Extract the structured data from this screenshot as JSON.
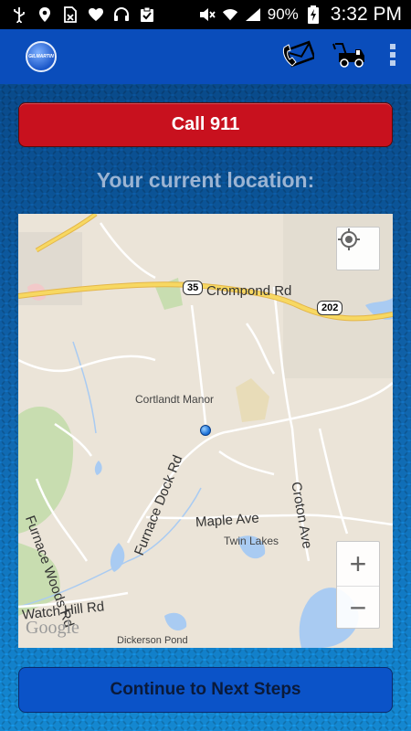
{
  "status_bar": {
    "battery_percent": "90%",
    "time": "3:32 PM"
  },
  "app_bar": {
    "logo_text": "GILMARTIN",
    "icons": [
      "phone-envelope-icon",
      "tow-truck-icon",
      "overflow-menu-icon"
    ]
  },
  "main": {
    "call_button_label": "Call 911",
    "location_label": "Your current location:",
    "continue_button_label": "Continue to Next Steps"
  },
  "map": {
    "labels": {
      "crompond_rd": "Crompond Rd",
      "route_35": "35",
      "route_202": "202",
      "cortlandt_manor": "Cortlandt Manor",
      "furnace_woods_rd": "Furnace Woods Rd",
      "furnace_dock_rd": "Furnace Dock Rd",
      "maple_ave": "Maple Ave",
      "croton_ave": "Croton Ave",
      "twin_lakes": "Twin Lakes",
      "watch_hill_rd": "Watch Hill Rd",
      "dickerson_pond": "Dickerson Pond",
      "google": "Google"
    },
    "zoom_in": "+",
    "zoom_out": "−"
  },
  "colors": {
    "call_red": "#c8111e",
    "app_bar_blue": "#0a4dbb",
    "continue_blue": "#0b53c8",
    "highway_yellow": "#f7d862",
    "water_blue": "#a9cbf2",
    "park_green": "#c8ddb0"
  }
}
